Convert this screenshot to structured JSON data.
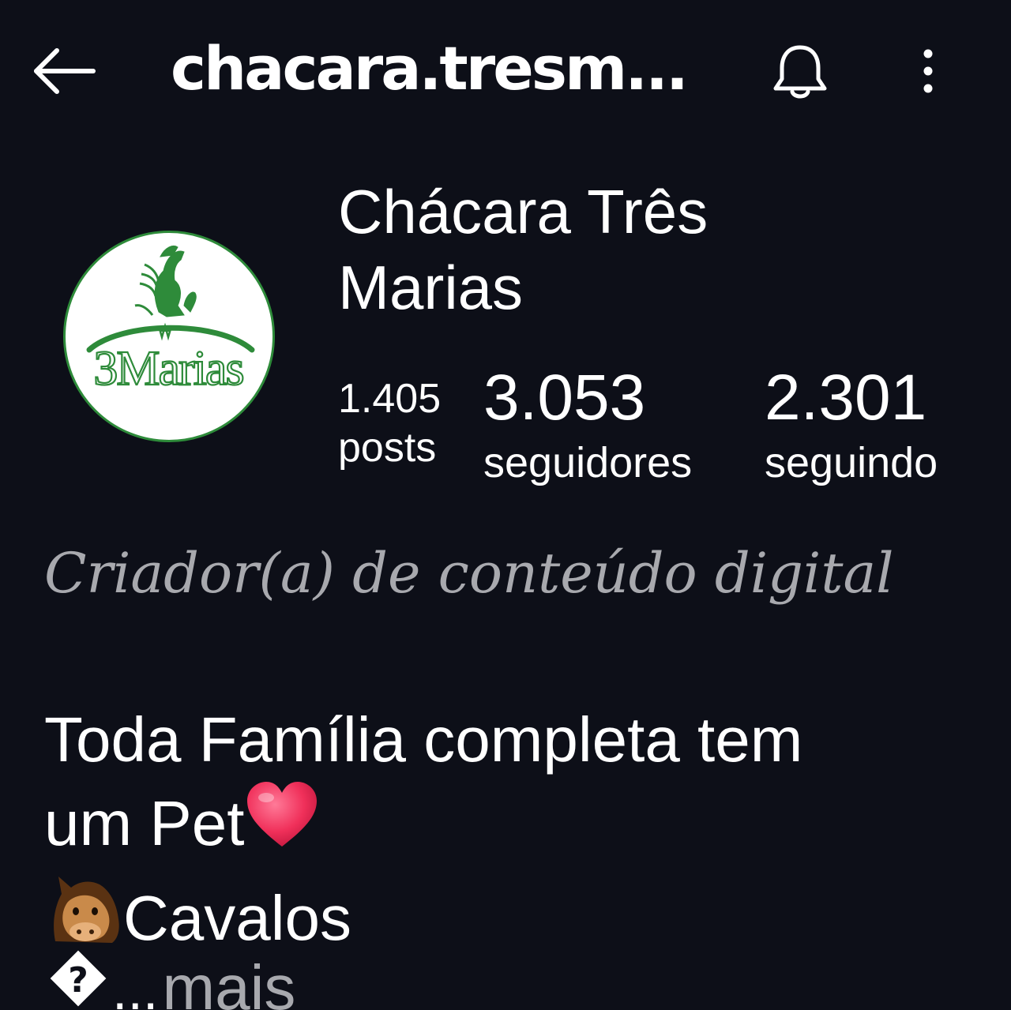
{
  "header": {
    "back_icon": "arrow-left-icon",
    "title": "chacara.tresm...",
    "bell_icon": "bell-icon",
    "more_icon": "more-vertical-icon"
  },
  "profile": {
    "avatar_logo_text": "3Marias",
    "name": "Chácara Três Marias",
    "stats": {
      "posts": {
        "value": "1.405",
        "label": "posts"
      },
      "followers": {
        "value": "3.053",
        "label": "seguidores"
      },
      "following": {
        "value": "2.301",
        "label": "seguindo"
      }
    },
    "category": "Criador(a) de conteúdo digital",
    "bio": {
      "line1": "Toda Família completa tem",
      "line2_text": "um Pet",
      "line2_emoji": "heart-emoji",
      "line3_emoji": "horse-face-emoji",
      "line3_text": "Cavalos",
      "truncation_glyph": "�",
      "ellipsis": "...",
      "more_label": "mais"
    }
  },
  "colors": {
    "background": "#0d0f18",
    "text_primary": "#ffffff",
    "text_secondary": "#a8a9ae",
    "logo_green": "#2e8b3a"
  }
}
